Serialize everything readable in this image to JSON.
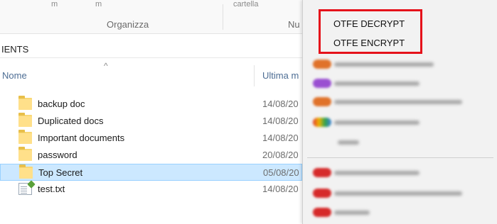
{
  "ribbon": {
    "fragments": [
      "m",
      "m",
      "cartella"
    ],
    "groups": [
      "Organizza",
      "Nu"
    ]
  },
  "address": {
    "path_visible": "IENTS"
  },
  "columns": {
    "sort_indicator": "^",
    "name": "Nome",
    "date": "Ultima m"
  },
  "files": [
    {
      "name": "backup doc",
      "date": "14/08/20",
      "type": "folder",
      "selected": false
    },
    {
      "name": "Duplicated docs",
      "date": "14/08/20",
      "type": "folder",
      "selected": false
    },
    {
      "name": "Important documents",
      "date": "14/08/20",
      "type": "folder",
      "selected": false
    },
    {
      "name": "password",
      "date": "20/08/20",
      "type": "folder",
      "selected": false
    },
    {
      "name": "Top Secret",
      "date": "05/08/20",
      "type": "folder",
      "selected": true
    },
    {
      "name": "test.txt",
      "date": "14/08/20",
      "type": "text-file",
      "selected": false
    }
  ],
  "context_menu": {
    "highlight_color": "#e5121b",
    "items": [
      "OTFE DECRYPT",
      "OTFE ENCRYPT"
    ],
    "blurred_entry_icon_colors": [
      "#e0722a",
      "#9a4fd1",
      "#e0722a",
      "#3f7fe0",
      "#d7d7d7",
      "#d62a2a",
      "#d62a2a",
      "#d62a2a"
    ]
  },
  "colors": {
    "selection_bg": "#cce8ff",
    "selection_border": "#99d1ff",
    "folder": "#ffe08a",
    "header_text": "#4d6d94"
  }
}
